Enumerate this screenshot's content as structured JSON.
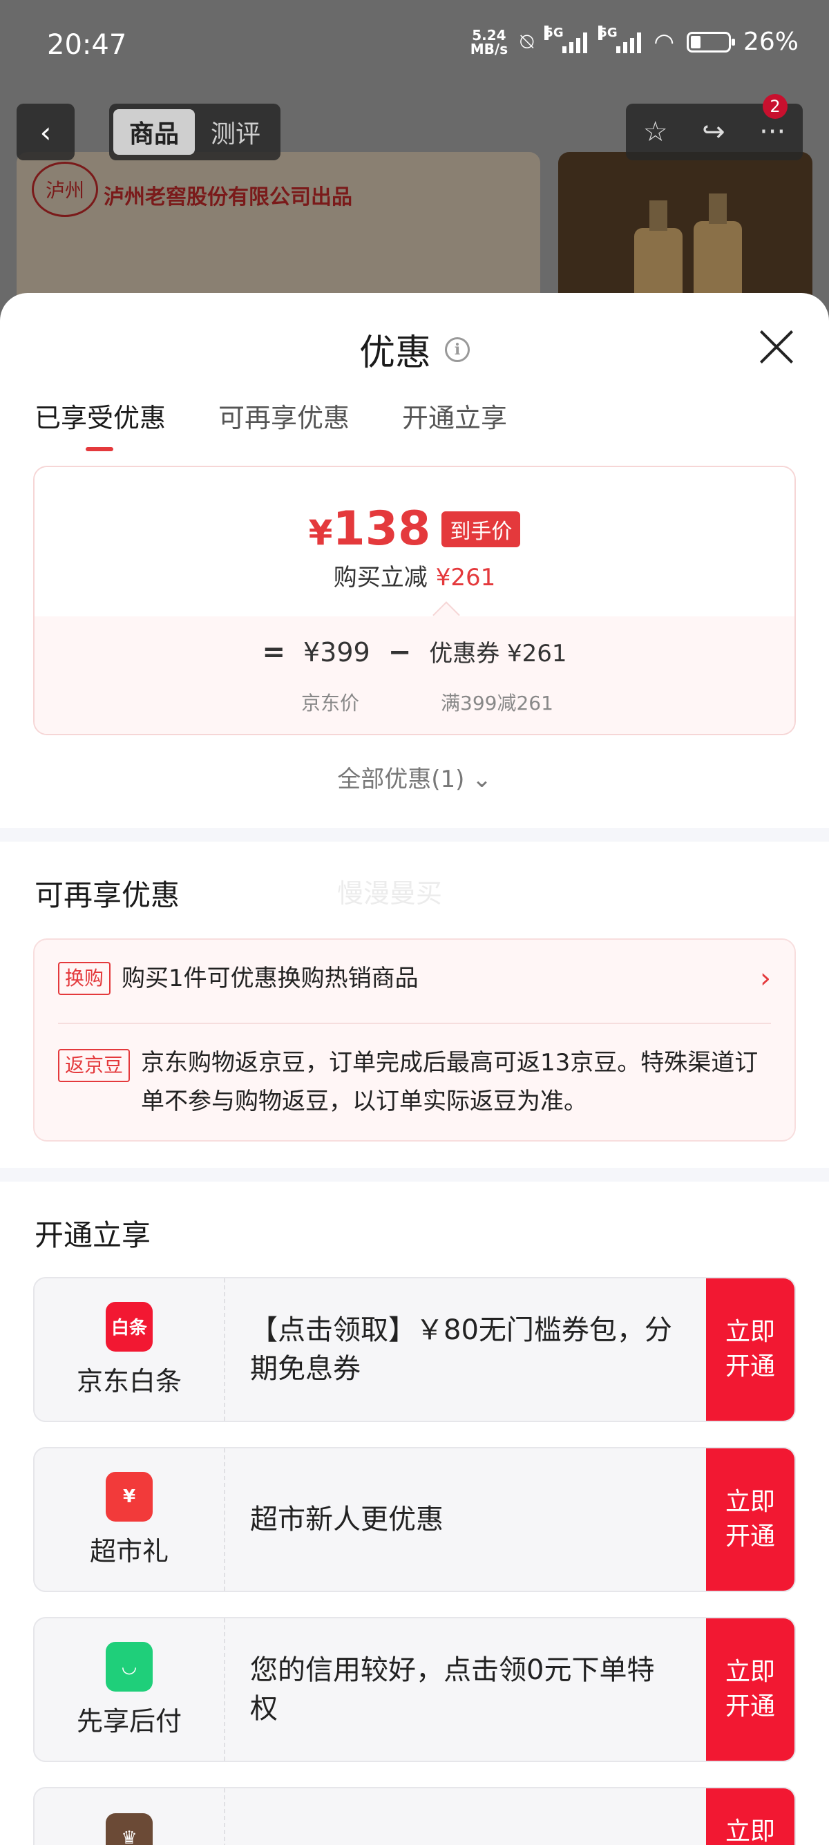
{
  "status": {
    "time": "20:47",
    "netspeed_value": "5.24",
    "netspeed_unit": "MB/s",
    "sig1_tag": "5G",
    "sig2_tag": "5G",
    "battery": "26%"
  },
  "top": {
    "back_glyph": "‹",
    "seg_goods": "商品",
    "seg_review": "测评",
    "badge": "2",
    "star_glyph": "☆",
    "share_glyph": "↪",
    "more_glyph": "···"
  },
  "banner": {
    "logo_char": "泸州",
    "brand_text": "泸州老窖股份有限公司出品"
  },
  "sheet": {
    "title": "优惠",
    "info_glyph": "i",
    "tabs": [
      "已享受优惠",
      "可再享优惠",
      "开通立享"
    ]
  },
  "price": {
    "yen": "¥",
    "amount": "138",
    "tag": "到手价",
    "sub_label": "购买立减",
    "sub_value": "¥261",
    "eq": "=",
    "jd_price": "¥399",
    "minus": "−",
    "coupon": "优惠券 ¥261",
    "jd_price_label": "京东价",
    "coupon_label": "满399减261"
  },
  "all_promo": "全部优惠(1) ⌄",
  "reenjoy": {
    "title": "可再享优惠",
    "watermark": "慢漫曼买",
    "items": [
      {
        "tag": "换购",
        "text": "购买1件可优惠换购热销商品",
        "chevron": "›"
      },
      {
        "tag": "返京豆",
        "text": "京东购物返京豆，订单完成后最高可返13京豆。特殊渠道订单不参与购物返豆，以订单实际返豆为准。"
      }
    ]
  },
  "open": {
    "title": "开通立享",
    "cards": [
      {
        "icon_text": "白条",
        "icon_color": "#f21832",
        "name": "京东白条",
        "desc": "【点击领取】￥80无门槛券包，分期免息券",
        "btn": "立即开通"
      },
      {
        "icon_text": "¥",
        "icon_color": "#f23a3a",
        "name": "超市礼",
        "desc": "超市新人更优惠",
        "btn": "立即开通"
      },
      {
        "icon_text": "◡",
        "icon_color": "#1fcf7a",
        "name": "先享后付",
        "desc": "您的信用较好，点击领0元下单特权",
        "btn": "立即开通"
      },
      {
        "icon_text": "♛",
        "icon_color": "#6b4a36",
        "name": "",
        "desc": "",
        "btn": "立即开通"
      }
    ]
  }
}
